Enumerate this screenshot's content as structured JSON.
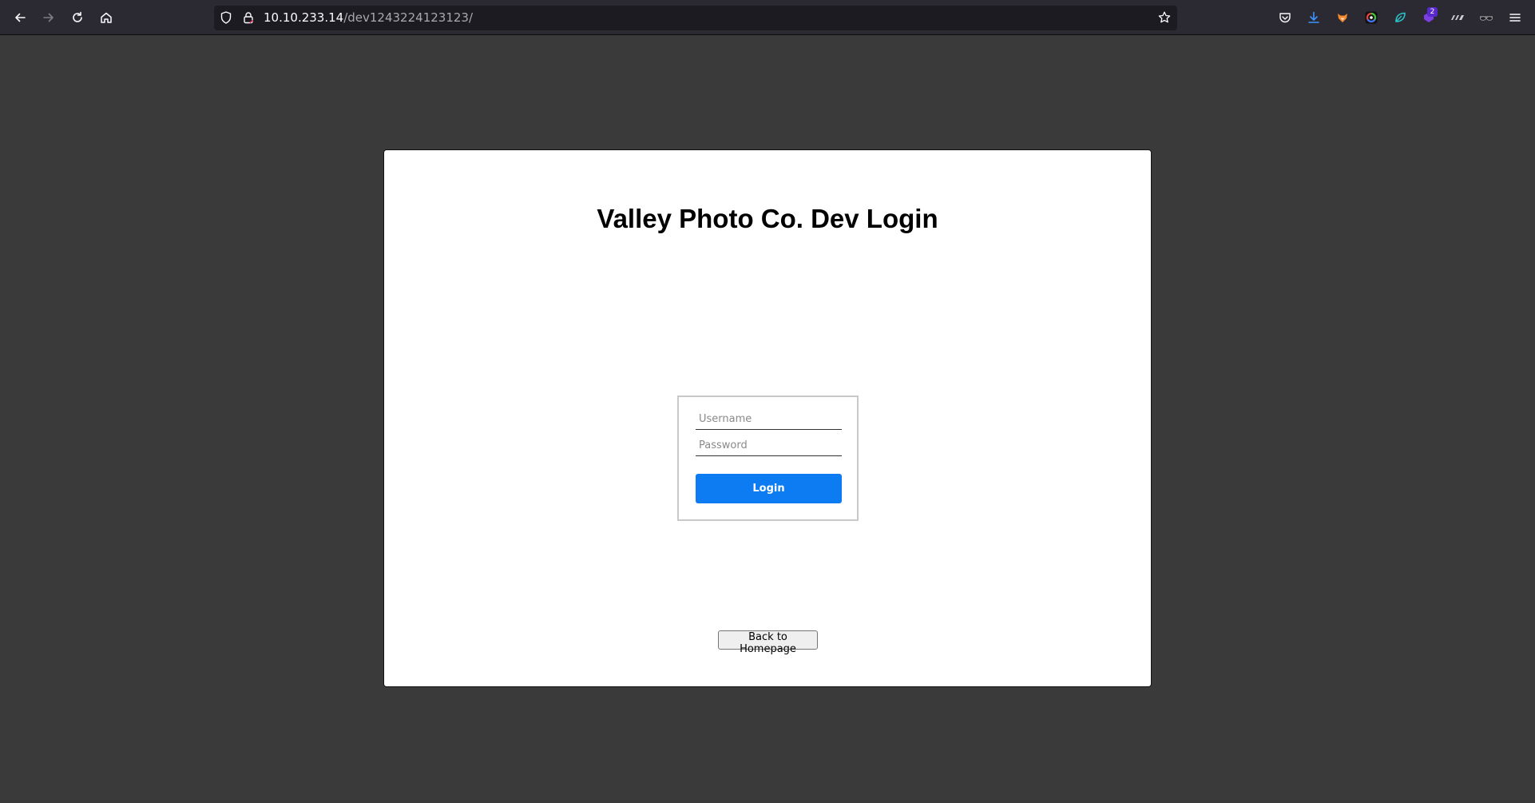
{
  "browser": {
    "url_host": "10.10.233.14",
    "url_path": "/dev1243224123123/",
    "extension_badge_count": "2",
    "icons": {
      "back": "arrow-left-icon",
      "forward": "arrow-right-icon",
      "reload": "reload-icon",
      "home": "home-icon",
      "tracking": "shield-icon",
      "security": "lock-icon",
      "bookmark": "star-icon",
      "pocket": "pocket-icon",
      "downloads": "download-icon",
      "menu": "hamburger-menu-icon"
    }
  },
  "page": {
    "title": "Valley Photo Co. Dev Login",
    "form": {
      "username_placeholder": "Username",
      "username_value": "",
      "password_placeholder": "Password",
      "password_value": "",
      "login_label": "Login"
    },
    "back_label": "Back to Homepage"
  },
  "colors": {
    "page_background": "#3a3a3a",
    "card_background": "#ffffff",
    "login_button": "#0d7cf2",
    "toolbar": "#2b2a33"
  }
}
